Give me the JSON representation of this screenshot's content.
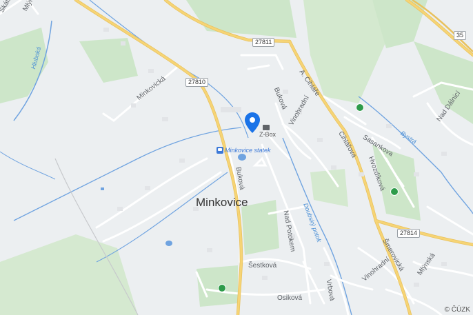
{
  "map": {
    "town": "Minkovice",
    "roads": [
      {
        "name": "Mlýnská"
      },
      {
        "name": "Minkovická"
      },
      {
        "name": "Buková"
      },
      {
        "name": "Buková"
      },
      {
        "name": "A. Cihláře"
      },
      {
        "name": "Cihlářova"
      },
      {
        "name": "Vinohradní"
      },
      {
        "name": "Vinohradní"
      },
      {
        "name": "Sasankova"
      },
      {
        "name": "Hvozdíková"
      },
      {
        "name": "Nad Dálnicí"
      },
      {
        "name": "Nad Potokem"
      },
      {
        "name": "Šestková"
      },
      {
        "name": "Osiková"
      },
      {
        "name": "Vrbová"
      },
      {
        "name": "Šmerovická"
      },
      {
        "name": "Mlýnská"
      },
      {
        "name": "Skálí"
      }
    ],
    "water": [
      {
        "name": "Hluboká"
      },
      {
        "name": "Doubský potok"
      },
      {
        "name": "Bystrá"
      }
    ],
    "shields": [
      "27811",
      "27810",
      "35",
      "27814"
    ],
    "transit_stop": "Minkovice statek",
    "poi_label": "Z-Box",
    "copyright": "© ČÚZK",
    "pin_icon": "location-pin-icon",
    "colors": {
      "background": "#eceff1",
      "major_road": "#f6d475",
      "minor_road": "#ffffff",
      "water": "#6fa3e0",
      "park": "#cde6c9",
      "pin": "#1a73e8"
    }
  }
}
